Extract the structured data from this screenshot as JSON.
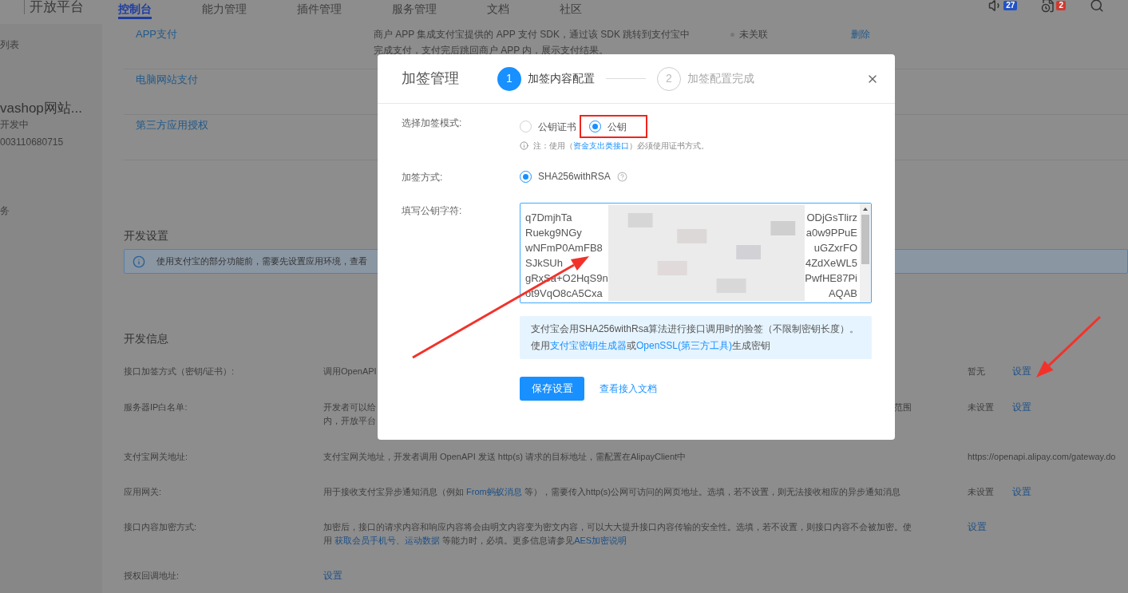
{
  "nav": {
    "brand": "开放平台",
    "tabs": [
      {
        "label": "控制台",
        "selected": true
      },
      {
        "label": "能力管理",
        "selected": false
      },
      {
        "label": "插件管理",
        "selected": false
      },
      {
        "label": "服务管理",
        "selected": false
      },
      {
        "label": "文档",
        "selected": false
      },
      {
        "label": "社区",
        "selected": false
      }
    ],
    "indicators": [
      {
        "kind": "speaker",
        "count": "27",
        "color": "#2352c4"
      },
      {
        "kind": "schedule",
        "count": "2",
        "color": "#cf3a30"
      },
      {
        "kind": "search"
      }
    ]
  },
  "sidebar": {
    "items": [
      {
        "kind": "link",
        "text": "列表"
      },
      {
        "kind": "app_name",
        "text": "vashop网站..."
      },
      {
        "kind": "app_status",
        "text": "开发中"
      },
      {
        "kind": "app_id",
        "text": "003110680715"
      },
      {
        "kind": "link",
        "text": "务"
      }
    ]
  },
  "products": [
    {
      "name": "APP支付",
      "description": [
        "商户 APP 集成支付宝提供的 APP 支付 SDK，通过该 SDK 跳转到支付宝中",
        "完成支付，支付完后跳回商户 APP 内，展示支付结果。"
      ],
      "status": "未关联",
      "action": "删除"
    },
    {
      "name": "电脑网站支付"
    },
    {
      "name": "第三方应用授权"
    }
  ],
  "dev_settings": {
    "title": "开发设置",
    "notice": "使用支付宝的部分功能前，需要先设置应用环境，查看"
  },
  "dev_info": {
    "title": "开发信息",
    "rows": [
      {
        "label": "接口加签方式（密钥/证书）:",
        "description": [
          [
            {
              "kind": "text",
              "text": "调用OpenAPI"
            }
          ]
        ],
        "value": "暂无",
        "action": "设置"
      },
      {
        "label": "服务器IP白名单:",
        "description": [
          [
            {
              "kind": "text",
              "text": "开发者可以给"
            }
          ],
          [
            {
              "kind": "text",
              "text": "内，开放平台"
            }
          ]
        ],
        "description_tail": "范围",
        "value": "未设置",
        "action": "设置"
      },
      {
        "label": "支付宝网关地址:",
        "description": [
          [
            {
              "kind": "text",
              "text": "支付宝网关地址，开发者调用 OpenAPI 发送 http(s) 请求的目标地址，需配置在AlipayClient中"
            }
          ]
        ],
        "value": "https://openapi.alipay.com/gateway.do"
      },
      {
        "label": "应用网关:",
        "description": [
          [
            {
              "kind": "text",
              "text": "用于接收支付宝异步通知消息（例如 "
            },
            {
              "kind": "link",
              "text": "From蚂蚁消息"
            },
            {
              "kind": "text",
              "text": " 等），需要传入http(s)公网可访问的网页地址。选填，若不设置，则无法接收相应的异步通知消息"
            }
          ]
        ],
        "value": "未设置",
        "action": "设置"
      },
      {
        "label": "接口内容加密方式:",
        "description": [
          [
            {
              "kind": "text",
              "text": "加密后，接口的请求内容和响应内容将会由明文内容变为密文内容，可以大大提升接口内容传输的安全性。选填，若不设置，则接口内容不会被加密。使"
            }
          ],
          [
            {
              "kind": "text",
              "text": "用 "
            },
            {
              "kind": "link",
              "text": "获取会员手机号"
            },
            {
              "kind": "text",
              "text": "、"
            },
            {
              "kind": "link",
              "text": "运动数据"
            },
            {
              "kind": "text",
              "text": " 等能力时，必填。更多信息请参见"
            },
            {
              "kind": "link",
              "text": "AES加密说明"
            }
          ]
        ],
        "action": "设置"
      },
      {
        "label": "授权回调地址:",
        "description": [
          [
            {
              "kind": "link",
              "text": "设置"
            }
          ]
        ]
      }
    ]
  },
  "dialog": {
    "title": "加签管理",
    "steps": [
      {
        "number": "1",
        "label": "加签内容配置",
        "selected": true
      },
      {
        "number": "2",
        "label": "加签配置完成",
        "selected": false
      }
    ],
    "fields": [
      {
        "kind": "radio",
        "label": "选择加签模式:",
        "options": [
          {
            "label": "公钥证书",
            "selected": false,
            "highlighted": false
          },
          {
            "label": "公钥",
            "selected": true,
            "highlighted": true
          }
        ],
        "note": [
          {
            "kind": "text",
            "text": "注：使用（"
          },
          {
            "kind": "link",
            "text": "资金支出类接口"
          },
          {
            "kind": "text",
            "text": "）必须使用证书方式。"
          }
        ]
      },
      {
        "kind": "radio",
        "label": "加签方式:",
        "options": [
          {
            "label": "SHA256withRSA",
            "selected": true,
            "highlighted": false,
            "help": true
          }
        ]
      },
      {
        "kind": "textarea",
        "label": "填写公钥字符:",
        "lines": [
          {
            "start": "q7DmjhTa",
            "end": "ODjGsTlirz"
          },
          {
            "start": "Ruekg9NGy",
            "end": "a0w9PPuE"
          },
          {
            "start": "wNFmP0AmFB8",
            "end": "uGZxrFO"
          },
          {
            "start": "SJkSUh",
            "end": "4ZdXeWL5"
          },
          {
            "start": "gRxSa+O2HqS9n",
            "end": "PwfHE87Pi"
          },
          {
            "start": "ot9VqO8cA5Cxa",
            "end": "AQAB"
          }
        ]
      }
    ],
    "info": [
      {
        "kind": "text",
        "text": "支付宝会用SHA256withRsa算法进行接口调用时的验签（不限制密钥长度）。使用"
      },
      {
        "kind": "link",
        "text": "支付宝密钥生成器"
      },
      {
        "kind": "text",
        "text": "或"
      },
      {
        "kind": "link",
        "text": "OpenSSL(第三方工具)"
      },
      {
        "kind": "text",
        "text": "生成密钥"
      }
    ],
    "buttons": [
      {
        "kind": "primary",
        "label": "保存设置"
      },
      {
        "kind": "link",
        "label": "查看接入文档"
      }
    ]
  }
}
